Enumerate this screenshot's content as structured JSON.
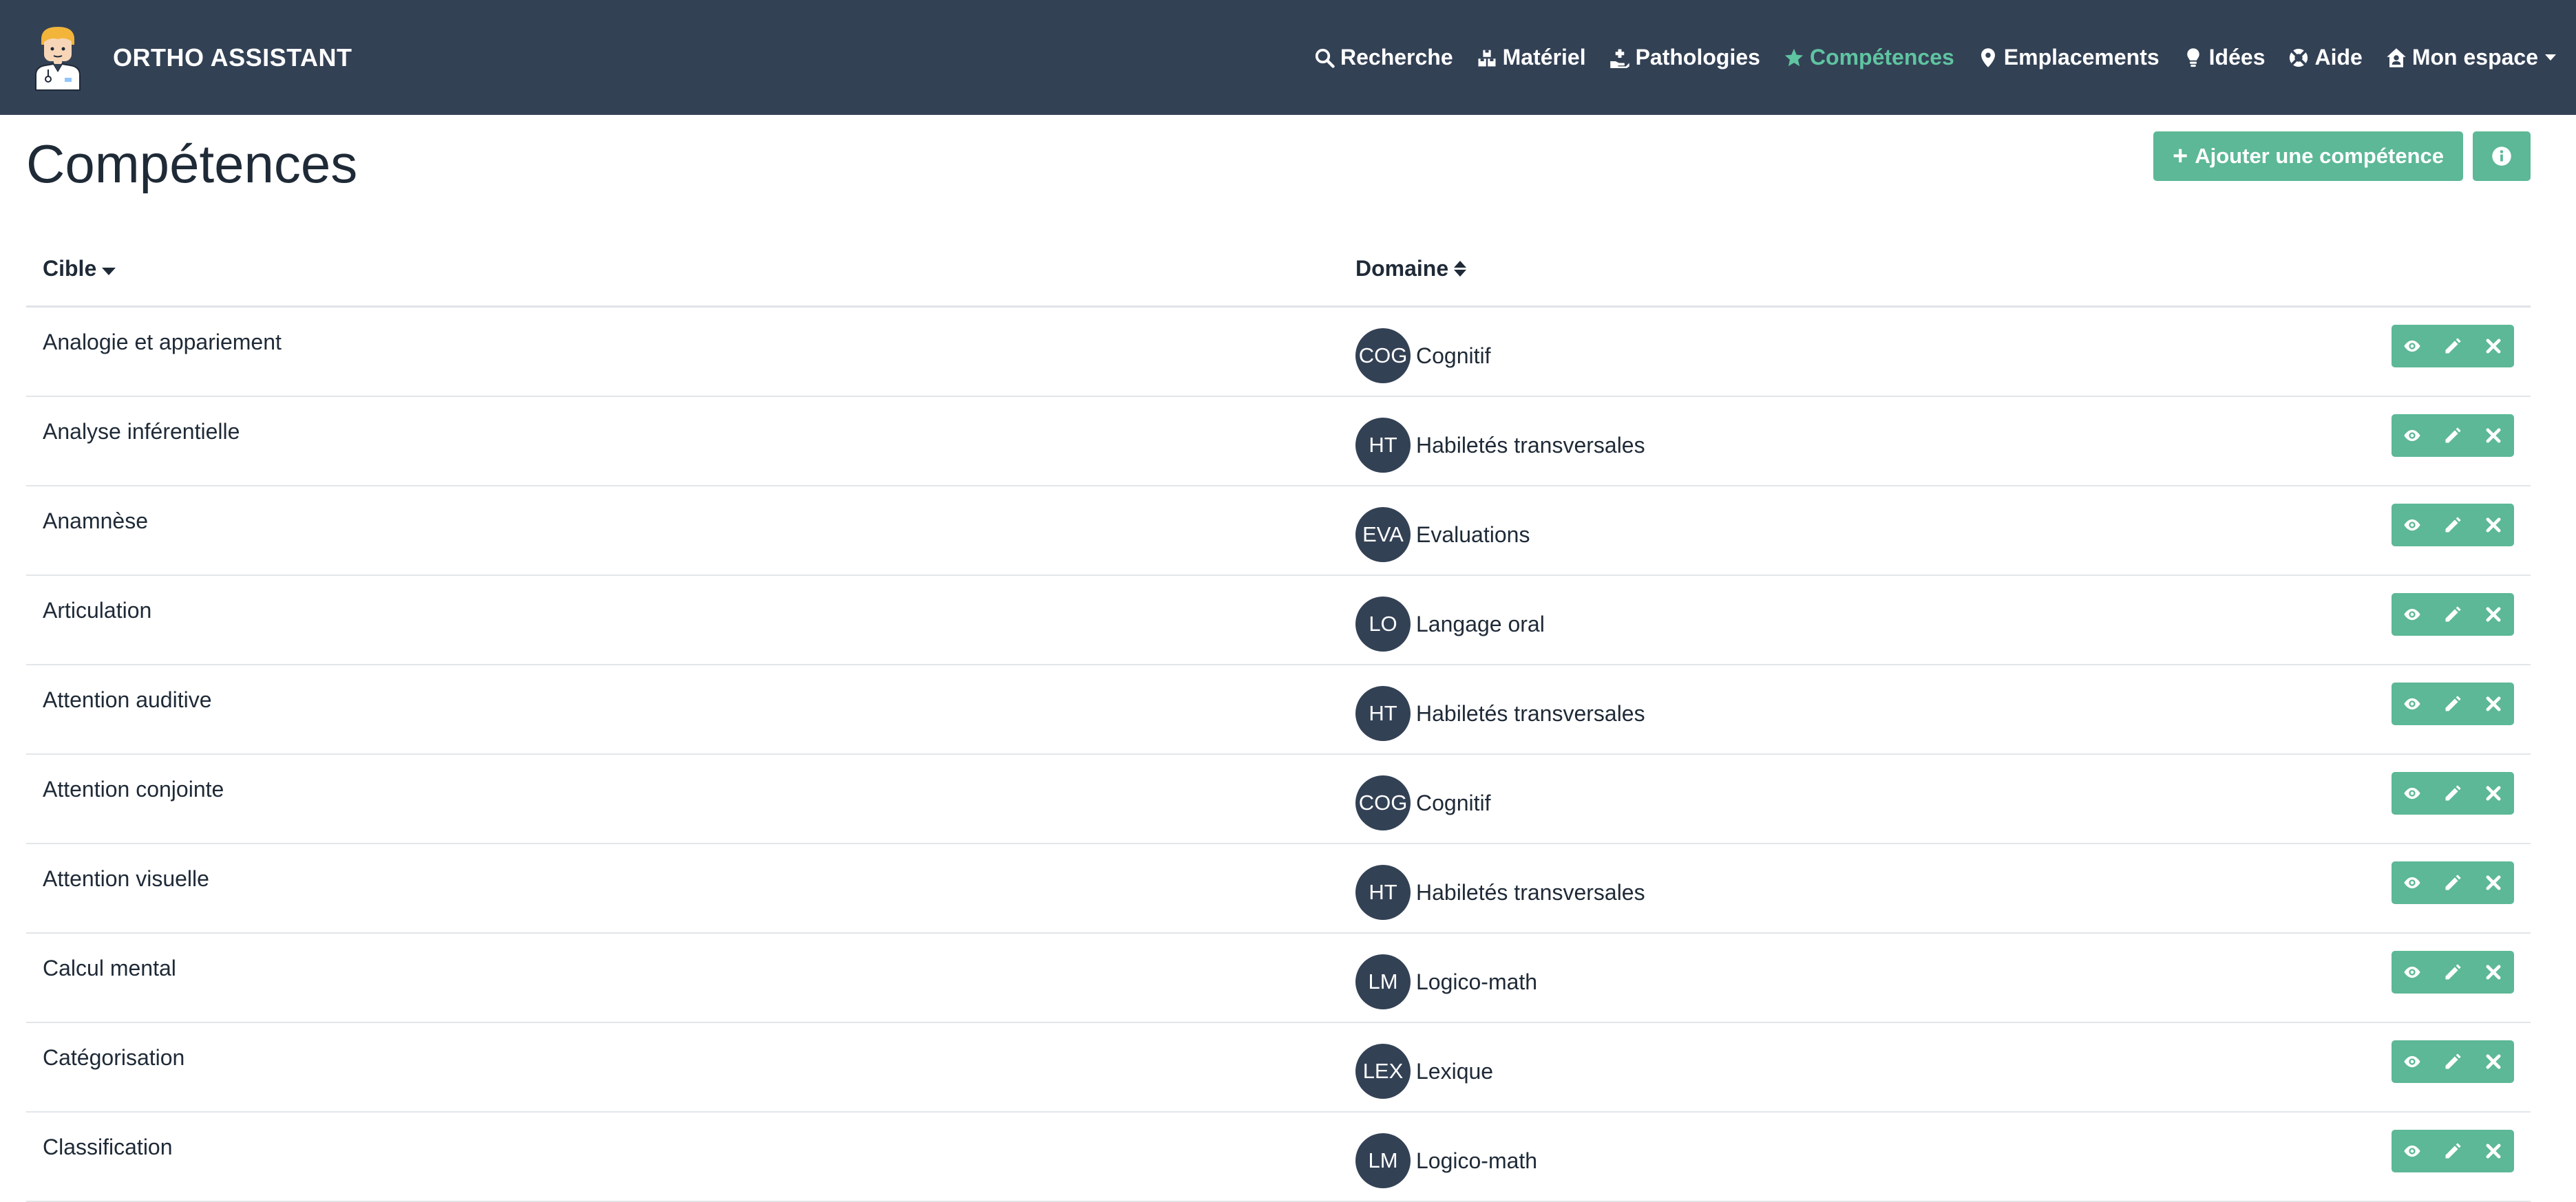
{
  "app": {
    "name": "ORTHO ASSISTANT"
  },
  "nav": {
    "items": [
      {
        "label": "Recherche",
        "icon": "search-icon"
      },
      {
        "label": "Matériel",
        "icon": "boxes-icon"
      },
      {
        "label": "Pathologies",
        "icon": "hand-holding-medical-icon"
      },
      {
        "label": "Compétences",
        "icon": "star-icon",
        "active": true
      },
      {
        "label": "Emplacements",
        "icon": "map-marker-icon"
      },
      {
        "label": "Idées",
        "icon": "lightbulb-icon"
      },
      {
        "label": "Aide",
        "icon": "life-ring-icon"
      },
      {
        "label": "Mon espace",
        "icon": "house-user-icon",
        "dropdown": true
      }
    ]
  },
  "page": {
    "title": "Compétences",
    "add_button": "Ajouter une compétence"
  },
  "table": {
    "headers": {
      "cible": "Cible",
      "domaine": "Domaine"
    },
    "rows": [
      {
        "cible": "Analogie et appariement",
        "badge": "COG",
        "domaine": "Cognitif"
      },
      {
        "cible": "Analyse inférentielle",
        "badge": "HT",
        "domaine": "Habiletés transversales"
      },
      {
        "cible": "Anamnèse",
        "badge": "EVA",
        "domaine": "Evaluations"
      },
      {
        "cible": "Articulation",
        "badge": "LO",
        "domaine": "Langage oral"
      },
      {
        "cible": "Attention auditive",
        "badge": "HT",
        "domaine": "Habiletés transversales"
      },
      {
        "cible": "Attention conjointe",
        "badge": "COG",
        "domaine": "Cognitif"
      },
      {
        "cible": "Attention visuelle",
        "badge": "HT",
        "domaine": "Habiletés transversales"
      },
      {
        "cible": "Calcul mental",
        "badge": "LM",
        "domaine": "Logico-math"
      },
      {
        "cible": "Catégorisation",
        "badge": "LEX",
        "domaine": "Lexique"
      },
      {
        "cible": "Classification",
        "badge": "LM",
        "domaine": "Logico-math"
      }
    ]
  },
  "colors": {
    "navbar": "#334155",
    "accent": "#5cb896",
    "active_nav": "#5fc4a0"
  }
}
